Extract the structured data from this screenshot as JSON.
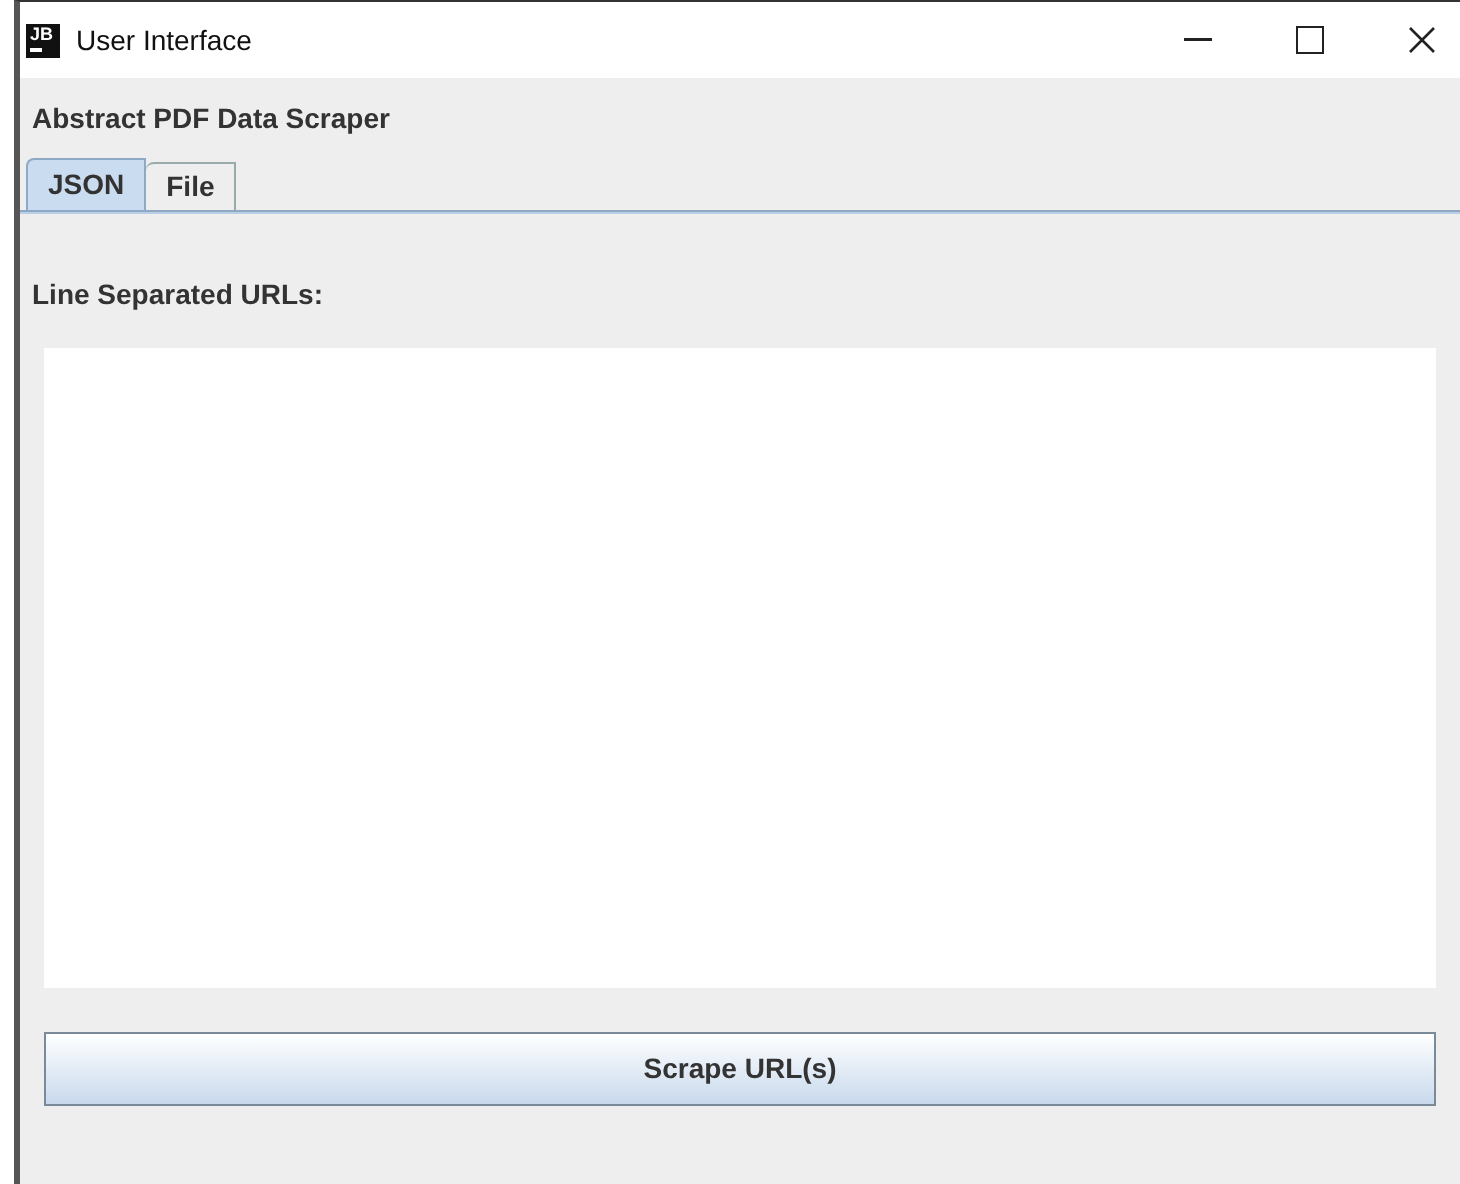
{
  "window": {
    "title": "User Interface",
    "icon_text": "JB"
  },
  "heading": "Abstract PDF Data Scraper",
  "tabs": [
    {
      "label": "JSON",
      "selected": true
    },
    {
      "label": "File",
      "selected": false
    }
  ],
  "urls_label": "Line Separated URLs:",
  "scrape_button": "Scrape URL(s)"
}
